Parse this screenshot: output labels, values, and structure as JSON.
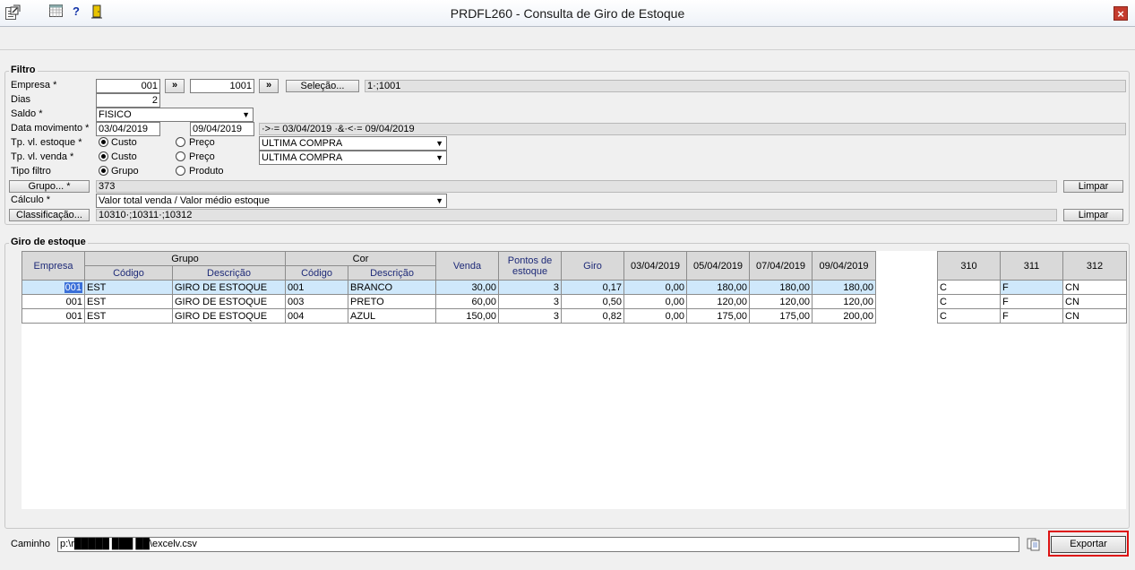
{
  "window": {
    "title": "PRDFL260 - Consulta de Giro de Estoque",
    "close_label": "×"
  },
  "toolbar": {
    "items": [
      "exit-icon",
      "calendar-icon",
      "help-icon",
      "door-icon"
    ],
    "help_glyph": "?"
  },
  "filtro": {
    "legend": "Filtro",
    "empresa": {
      "label": "Empresa *",
      "from": "001",
      "to": "1001",
      "arrow": "»",
      "selecao_label": "Seleção...",
      "selection_text": "1·;1001"
    },
    "dias": {
      "label": "Dias",
      "value": "2"
    },
    "saldo": {
      "label": "Saldo *",
      "value": "FISICO"
    },
    "data_movimento": {
      "label": "Data movimento *",
      "from": "03/04/2019",
      "to": "09/04/2019",
      "summary": "·>·= 03/04/2019 ·&·<·= 09/04/2019"
    },
    "tp_vl_estoque": {
      "label": "Tp. vl. estoque *",
      "opt1": "Custo",
      "opt2": "Preço",
      "select": "ULTIMA COMPRA"
    },
    "tp_vl_venda": {
      "label": "Tp. vl. venda *",
      "opt1": "Custo",
      "opt2": "Preço",
      "select": "ULTIMA COMPRA"
    },
    "tipo_filtro": {
      "label": "Tipo filtro",
      "opt1": "Grupo",
      "opt2": "Produto"
    },
    "grupo": {
      "button": "Grupo... *",
      "value": "373",
      "limpar": "Limpar"
    },
    "calculo": {
      "label": "Cálculo *",
      "value": "Valor total venda / Valor médio estoque"
    },
    "classificacao": {
      "button": "Classificação...",
      "value": "10310·;10311·;10312",
      "limpar": "Limpar"
    }
  },
  "giro": {
    "legend": "Giro de estoque",
    "headers": {
      "empresa": "Empresa",
      "grupo": "Grupo",
      "cor": "Cor",
      "codigo": "Código",
      "descricao": "Descrição",
      "venda": "Venda",
      "pontos": "Pontos de estoque",
      "giro": "Giro",
      "d1": "03/04/2019",
      "d2": "05/04/2019",
      "d3": "07/04/2019",
      "d4": "09/04/2019",
      "c310": "310",
      "c311": "311",
      "c312": "312"
    },
    "rows": [
      {
        "empresa": "001",
        "grupo_cod": "EST",
        "grupo_desc": "GIRO DE ESTOQUE",
        "cor_cod": "001",
        "cor_desc": "BRANCO",
        "venda": "30,00",
        "pontos": "3",
        "giro": "0,17",
        "d1": "0,00",
        "d2": "180,00",
        "d3": "180,00",
        "d4": "180,00",
        "c310": "C",
        "c311": "F",
        "c312": "CN"
      },
      {
        "empresa": "001",
        "grupo_cod": "EST",
        "grupo_desc": "GIRO DE ESTOQUE",
        "cor_cod": "003",
        "cor_desc": "PRETO",
        "venda": "60,00",
        "pontos": "3",
        "giro": "0,50",
        "d1": "0,00",
        "d2": "120,00",
        "d3": "120,00",
        "d4": "120,00",
        "c310": "C",
        "c311": "F",
        "c312": "CN"
      },
      {
        "empresa": "001",
        "grupo_cod": "EST",
        "grupo_desc": "GIRO DE ESTOQUE",
        "cor_cod": "004",
        "cor_desc": "AZUL",
        "venda": "150,00",
        "pontos": "3",
        "giro": "0,82",
        "d1": "0,00",
        "d2": "175,00",
        "d3": "175,00",
        "d4": "200,00",
        "c310": "C",
        "c311": "F",
        "c312": "CN"
      }
    ]
  },
  "footer": {
    "caminho_label": "Caminho",
    "caminho_value": "p:\\r█████ ███ ██\\excelv.csv",
    "exportar_label": "Exportar"
  }
}
